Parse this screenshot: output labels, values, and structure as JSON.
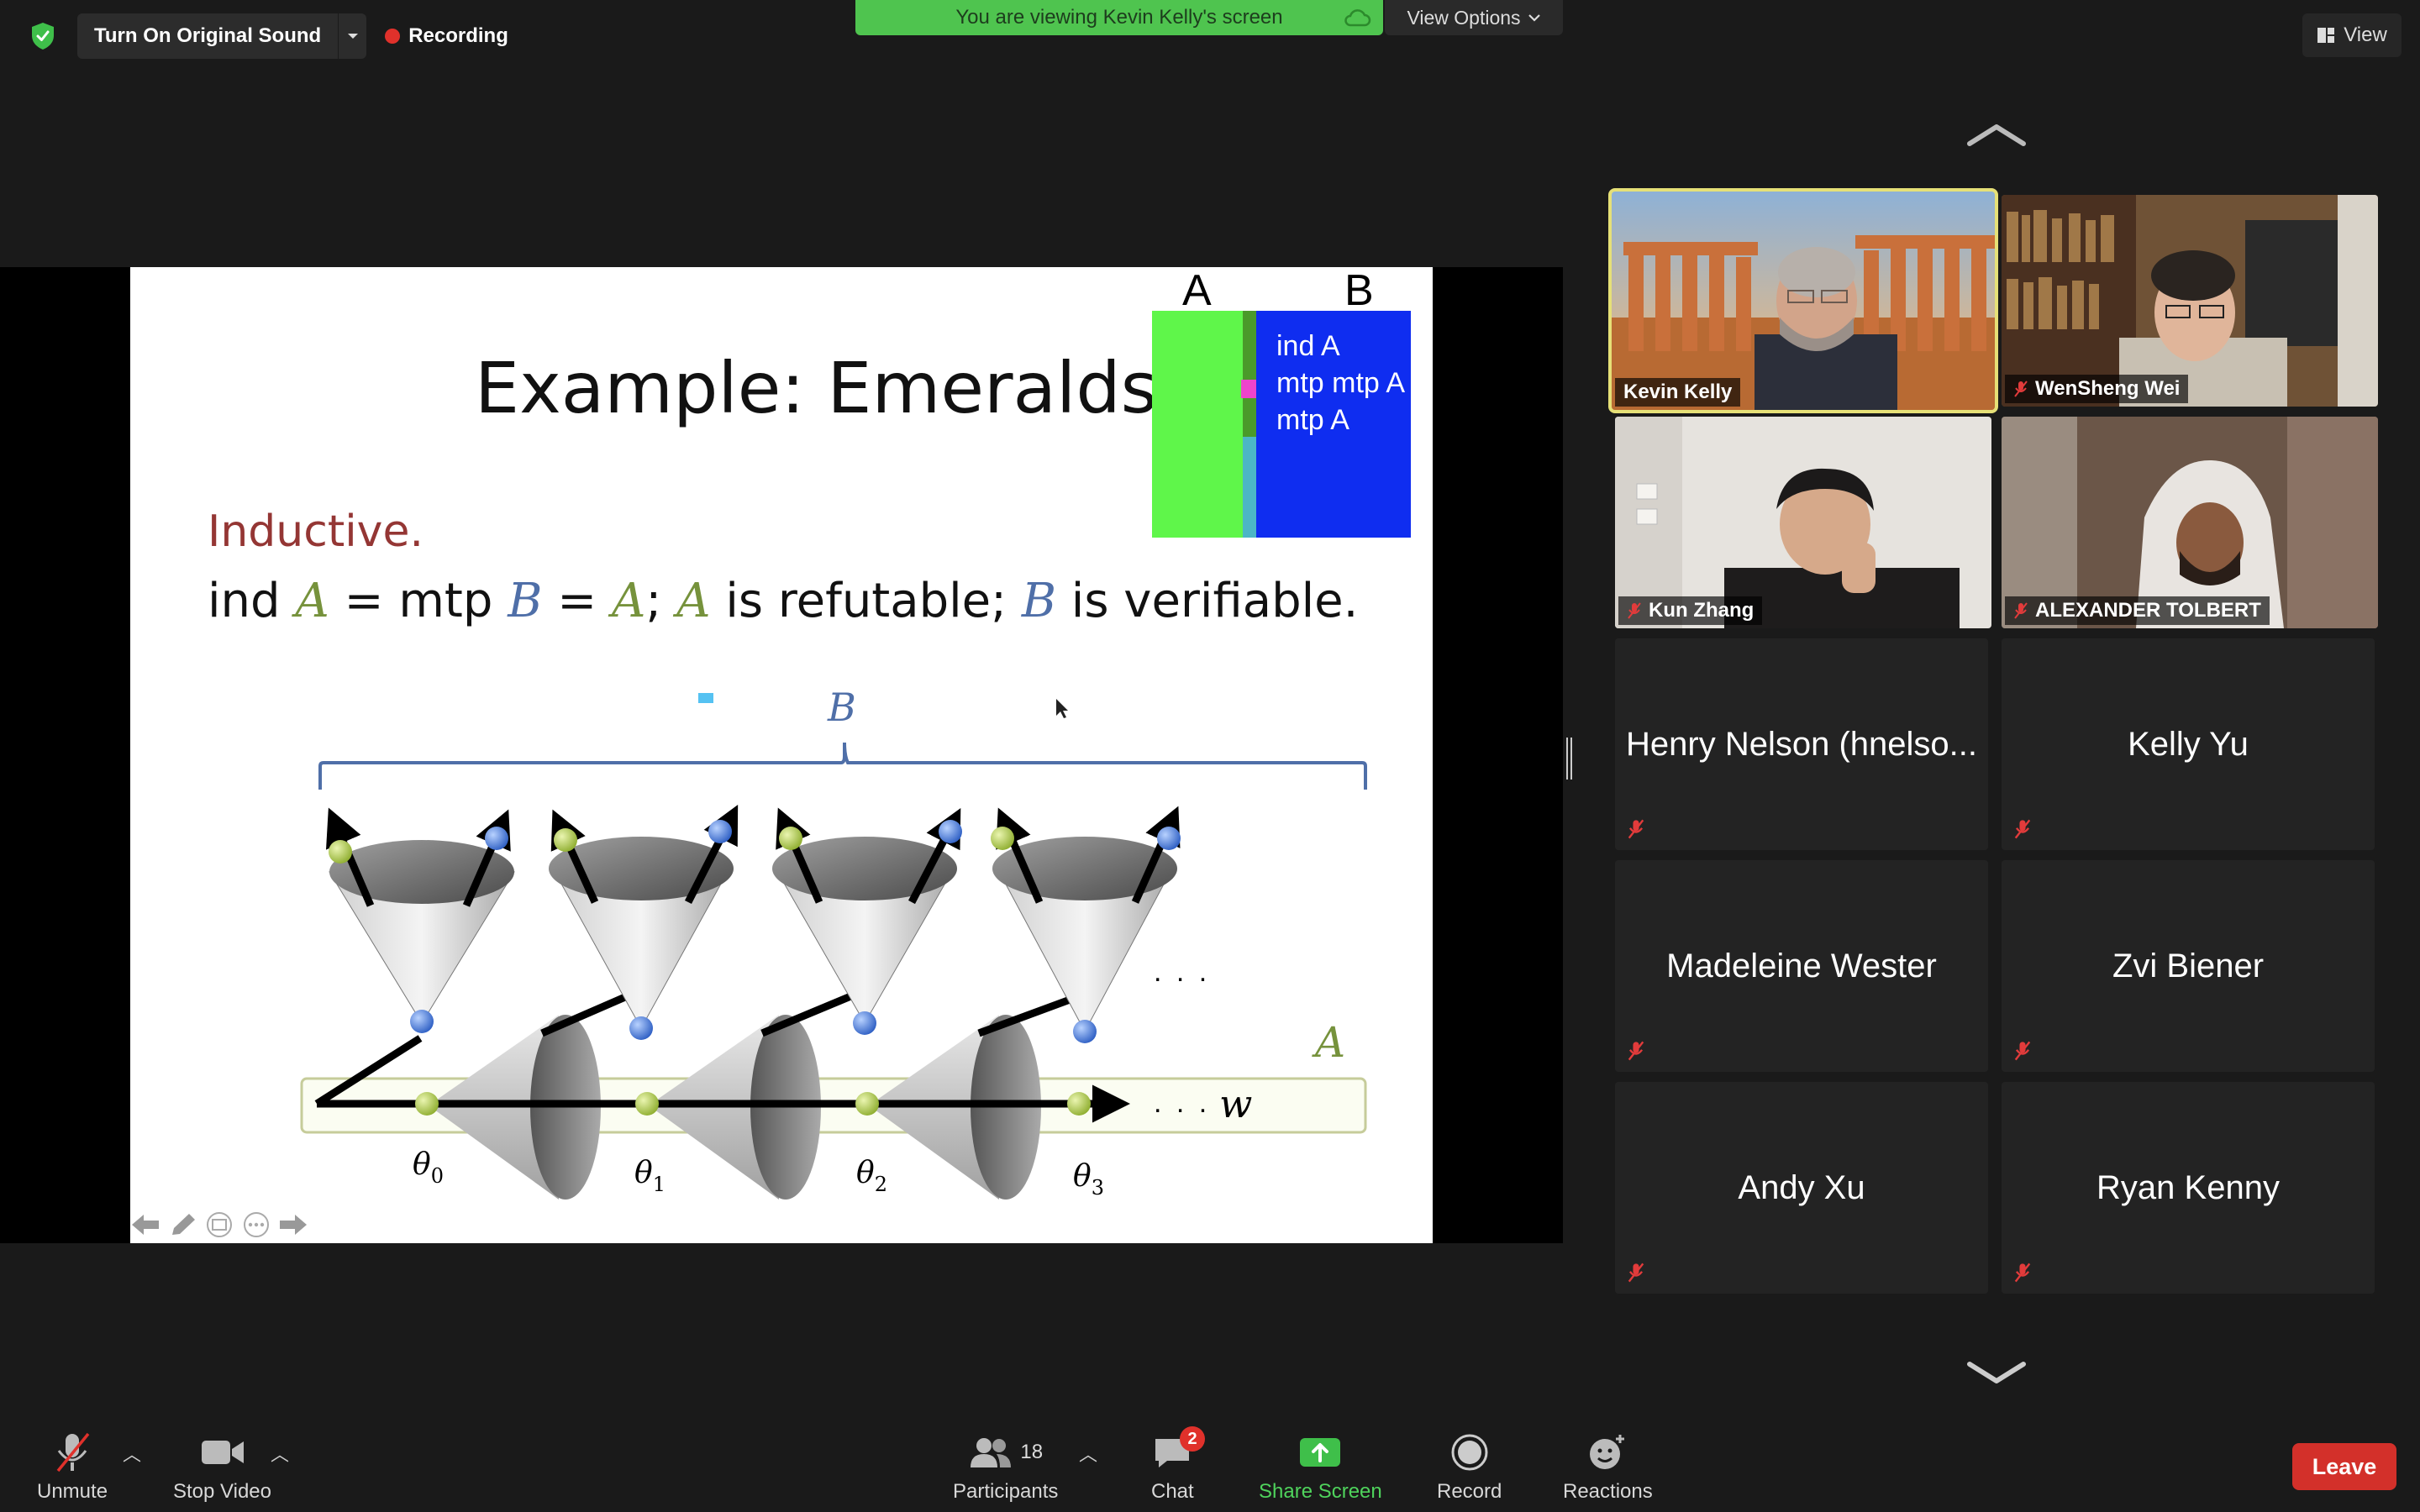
{
  "top_bar": {
    "original_sound_label": "Turn On Original Sound",
    "recording_label": "Recording",
    "viewing_banner": "You are viewing Kevin Kelly's screen",
    "view_options_label": "View Options",
    "view_label": "View"
  },
  "slide": {
    "title": "Example: Emeralds",
    "subtitle": "Inductive.",
    "formula": {
      "p1": "ind ",
      "A1": "A",
      "p2": " = mtp ",
      "B1": "B",
      "p3": " = ",
      "A2": "A",
      "p4": ";  ",
      "A3": "A",
      "p5": " is refutable;  ",
      "B2": "B",
      "p6": " is verifiable."
    },
    "box_label_a": "A",
    "box_label_b": "B",
    "box_lines": [
      "ind A",
      "mtp mtp A",
      "mtp A"
    ],
    "diagram": {
      "brace_label": "B",
      "set_label": "A",
      "world_label": "w",
      "ellipsis_1": ". . .",
      "ellipsis_2": ". . .",
      "theta_labels": [
        "θ",
        "θ",
        "θ",
        "θ"
      ],
      "theta_subs": [
        "0",
        "1",
        "2",
        "3"
      ]
    }
  },
  "participants": [
    {
      "name": "Kevin Kelly",
      "muted": false,
      "video": true,
      "active": true
    },
    {
      "name": "WenSheng Wei",
      "muted": true,
      "video": true
    },
    {
      "name": "Kun Zhang",
      "muted": true,
      "video": true
    },
    {
      "name": "ALEXANDER TOLBERT",
      "muted": true,
      "video": true
    },
    {
      "name": "Henry Nelson (hnelso...",
      "muted": true,
      "video": false
    },
    {
      "name": "Kelly Yu",
      "muted": true,
      "video": false
    },
    {
      "name": "Madeleine Wester",
      "muted": true,
      "video": false
    },
    {
      "name": "Zvi Biener",
      "muted": true,
      "video": false
    },
    {
      "name": "Andy Xu",
      "muted": true,
      "video": false
    },
    {
      "name": "Ryan Kenny",
      "muted": true,
      "video": false
    }
  ],
  "toolbar": {
    "unmute": "Unmute",
    "stop_video": "Stop Video",
    "participants": "Participants",
    "participants_count": "18",
    "chat": "Chat",
    "chat_badge": "2",
    "share_screen": "Share Screen",
    "record": "Record",
    "reactions": "Reactions",
    "leave": "Leave"
  },
  "colors": {
    "banner_green": "#4fc44f",
    "active_speaker": "#e6e077",
    "leave_red": "#d3302a",
    "slide_subtitle": "#943634",
    "formula_A": "#76923c",
    "formula_B": "#4f6fa8"
  }
}
